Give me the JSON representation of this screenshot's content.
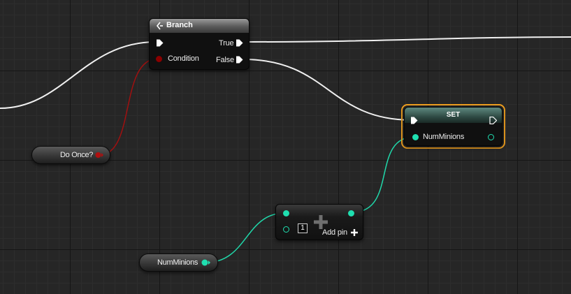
{
  "branch": {
    "title": "Branch",
    "condition": "Condition",
    "true_label": "True",
    "false_label": "False"
  },
  "do_once": {
    "label": "Do Once?"
  },
  "set": {
    "title": "SET",
    "var": "NumMinions"
  },
  "add_node": {
    "index": "1",
    "add_pin": "Add pin"
  },
  "num_minions": {
    "label": "NumMinions"
  },
  "colors": {
    "exec": "#ffffff",
    "bool": "#8b0000",
    "int": "#1fdfb0",
    "selection": "#f0a020"
  }
}
